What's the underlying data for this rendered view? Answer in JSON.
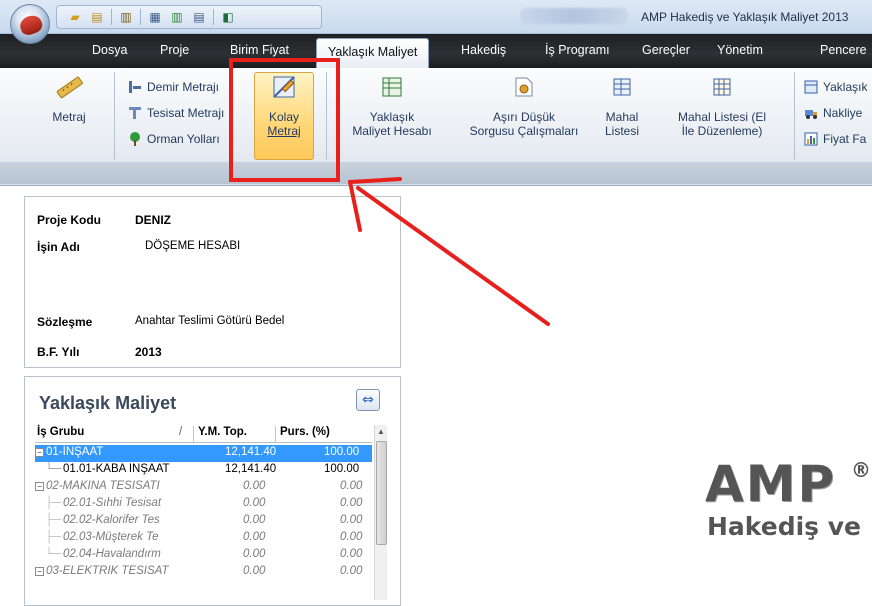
{
  "window": {
    "title": "AMP Hakediş ve Yaklaşık Maliyet 2013"
  },
  "tabs": [
    {
      "label": "Dosya"
    },
    {
      "label": "Proje"
    },
    {
      "label": "Birim Fiyat"
    },
    {
      "label": "Yaklaşık Maliyet",
      "active": true
    },
    {
      "label": "Hakediş"
    },
    {
      "label": "İş Programı"
    },
    {
      "label": "Gereçler"
    },
    {
      "label": "Yönetim"
    },
    {
      "label": "Pencere"
    }
  ],
  "ribbon": {
    "metraj": "Metraj",
    "demir_metraji": "Demir Metrajı",
    "tesisat_metraji": "Tesisat Metrajı",
    "orman_yollari": "Orman Yolları",
    "kolay_1": "Kolay",
    "kolay_2": "Metraj",
    "yaklasik_1": "Yaklaşık",
    "yaklasik_2": "Maliyet Hesabı",
    "asiri_1": "Aşırı Düşük",
    "asiri_2": "Sorgusu Çalışmaları",
    "mahal_1": "Mahal",
    "mahal_2": "Listesi",
    "mahal_el_1": "Mahal Listesi (El",
    "mahal_el_2": "İle Düzenleme)",
    "right_1": "Yaklaşık",
    "right_2": "Nakliye",
    "right_3": "Fiyat Fa"
  },
  "project": {
    "kod_label": "Proje Kodu",
    "kod_value": "DENIZ",
    "isin_adi_label": "İşin Adı",
    "isin_adi_value": "DÖŞEME HESABI",
    "sozlesme_label": "Sözleşme",
    "sozlesme_value": "Anahtar Teslimi Götürü Bedel",
    "bf_yili_label": "B.F. Yılı",
    "bf_yili_value": "2013"
  },
  "yaklasik_panel": {
    "title": "Yaklaşık Maliyet",
    "columns": [
      "İş Grubu",
      "Y.M. Top.",
      "Purs. (%)"
    ],
    "rows": [
      {
        "name": "01-İNŞAAT",
        "ym": "12,141.40",
        "purs": "100.00"
      },
      {
        "name": "01.01-KABA İNŞAAT",
        "ym": "12,141.40",
        "purs": "100.00"
      },
      {
        "name": "02-MAKİNA TESİSATI",
        "ym": "0.00",
        "purs": "0.00"
      },
      {
        "name": "02.01-Sıhhi Tesisat",
        "ym": "0.00",
        "purs": "0.00"
      },
      {
        "name": "02.02-Kalorifer Tes",
        "ym": "0.00",
        "purs": "0.00"
      },
      {
        "name": "02.03-Müşterek Te",
        "ym": "0.00",
        "purs": "0.00"
      },
      {
        "name": "02.04-Havalandırm",
        "ym": "0.00",
        "purs": "0.00"
      },
      {
        "name": "03-ELEKTRİK TESİSAT",
        "ym": "0.00",
        "purs": "0.00"
      }
    ]
  },
  "logo": {
    "main": "AMP",
    "reg": "®",
    "sub": "Hakediş ve"
  },
  "colors": {
    "highlight": "#e8201c",
    "selection": "#3399ff"
  }
}
